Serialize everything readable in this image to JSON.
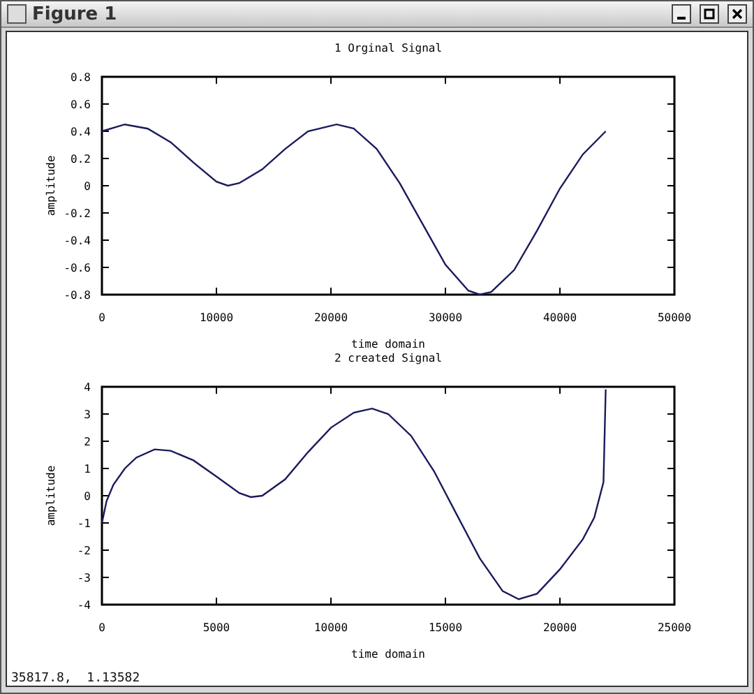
{
  "window": {
    "title": "Figure 1"
  },
  "charts": [
    {
      "chart_data": {
        "type": "line",
        "title": "1 Orginal Signal",
        "xlabel": "time domain",
        "ylabel": "amplitude",
        "xlim": [
          0,
          50000
        ],
        "ylim": [
          -0.8,
          0.8
        ],
        "xticks": [
          0,
          10000,
          20000,
          30000,
          40000,
          50000
        ],
        "yticks": [
          0.8,
          0.6,
          0.4,
          0.2,
          0,
          -0.2,
          -0.4,
          -0.6,
          -0.8
        ],
        "x": [
          0,
          2000,
          4000,
          6000,
          8000,
          10000,
          11000,
          12000,
          14000,
          16000,
          18000,
          20500,
          22000,
          24000,
          26000,
          28000,
          30000,
          32000,
          33000,
          34000,
          36000,
          38000,
          40000,
          42000,
          44000
        ],
        "series": [
          {
            "color": "#1a1a5c",
            "values": [
              0.4,
              0.45,
              0.42,
              0.32,
              0.17,
              0.03,
              0,
              0.02,
              0.12,
              0.27,
              0.4,
              0.45,
              0.42,
              0.27,
              0.02,
              -0.28,
              -0.58,
              -0.77,
              -0.8,
              -0.78,
              -0.62,
              -0.33,
              -0.02,
              0.23,
              0.4
            ]
          }
        ]
      }
    },
    {
      "chart_data": {
        "type": "line",
        "title": "2 created Signal",
        "xlabel": "time domain",
        "ylabel": "amplitude",
        "xlim": [
          0,
          25000
        ],
        "ylim": [
          -4,
          4
        ],
        "xticks": [
          0,
          5000,
          10000,
          15000,
          20000,
          25000
        ],
        "yticks": [
          4,
          3,
          2,
          1,
          0,
          -1,
          -2,
          -3,
          -4
        ],
        "x": [
          0,
          200,
          500,
          1000,
          1500,
          2300,
          3000,
          4000,
          5000,
          6000,
          6500,
          7000,
          8000,
          9000,
          10000,
          11000,
          11800,
          12500,
          13500,
          14500,
          15500,
          16500,
          17500,
          18200,
          19000,
          20000,
          21000,
          21500,
          21900,
          22000
        ],
        "series": [
          {
            "color": "#1a1a5c",
            "values": [
              -1,
              -0.2,
              0.4,
              1.0,
              1.4,
              1.7,
              1.65,
              1.3,
              0.7,
              0.1,
              -0.05,
              0,
              0.6,
              1.6,
              2.5,
              3.05,
              3.2,
              3.0,
              2.2,
              0.9,
              -0.7,
              -2.3,
              -3.5,
              -3.8,
              -3.6,
              -2.7,
              -1.6,
              -0.8,
              0.5,
              3.9
            ]
          }
        ]
      }
    }
  ],
  "status_bar": {
    "coordinates": "35817.8,  1.13582"
  }
}
